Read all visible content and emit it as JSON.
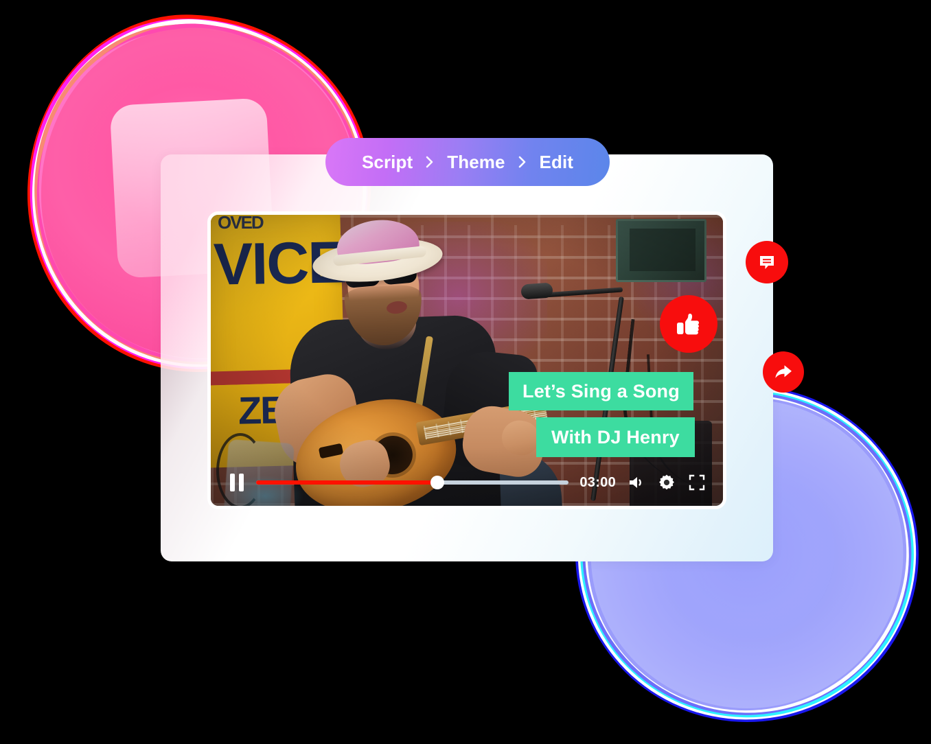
{
  "breadcrumb": {
    "name": "wizard-breadcrumb",
    "steps": [
      {
        "label": "Script"
      },
      {
        "label": "Theme"
      },
      {
        "label": "Edit"
      }
    ],
    "separator_icon": "chevron-right-icon",
    "gradient_start": "#d977f7",
    "gradient_end": "#5b86ea"
  },
  "video": {
    "captions": [
      {
        "text": "Let’s Sing a Song"
      },
      {
        "text": "With DJ Henry"
      }
    ],
    "caption_bg": "#3ddCa0",
    "caption_color": "#ffffff",
    "scene_description": "Bearded man in white and pink fedora and sunglasses singing into a microphone while playing an acoustic guitar in front of a brick wall with a yellow SERVICE sign",
    "sign_text_main": "VICE",
    "sign_text_top": "OVED",
    "sign_text_bottom": "ZE"
  },
  "player": {
    "pause_icon": "pause-icon",
    "time": "03:00",
    "progress_percent": 58,
    "progress_filled_color": "#ff1100",
    "progress_track_color": "#c6d2dd",
    "volume_icon": "volume-icon",
    "settings_icon": "gear-icon",
    "fullscreen_icon": "fullscreen-icon"
  },
  "social_actions": [
    {
      "name": "comment",
      "icon": "comment-icon",
      "color": "#f80d0d"
    },
    {
      "name": "like",
      "icon": "thumbs-up-icon",
      "color": "#f80d0d"
    },
    {
      "name": "share",
      "icon": "share-arrow-icon",
      "color": "#f80d0d"
    }
  ],
  "decor": {
    "pink_blob_color": "#ff59a5",
    "blue_blob_color": "#a4a8fb",
    "panel_bg_start": "#ffd6e8",
    "panel_bg_end": "#dcf0fb"
  }
}
